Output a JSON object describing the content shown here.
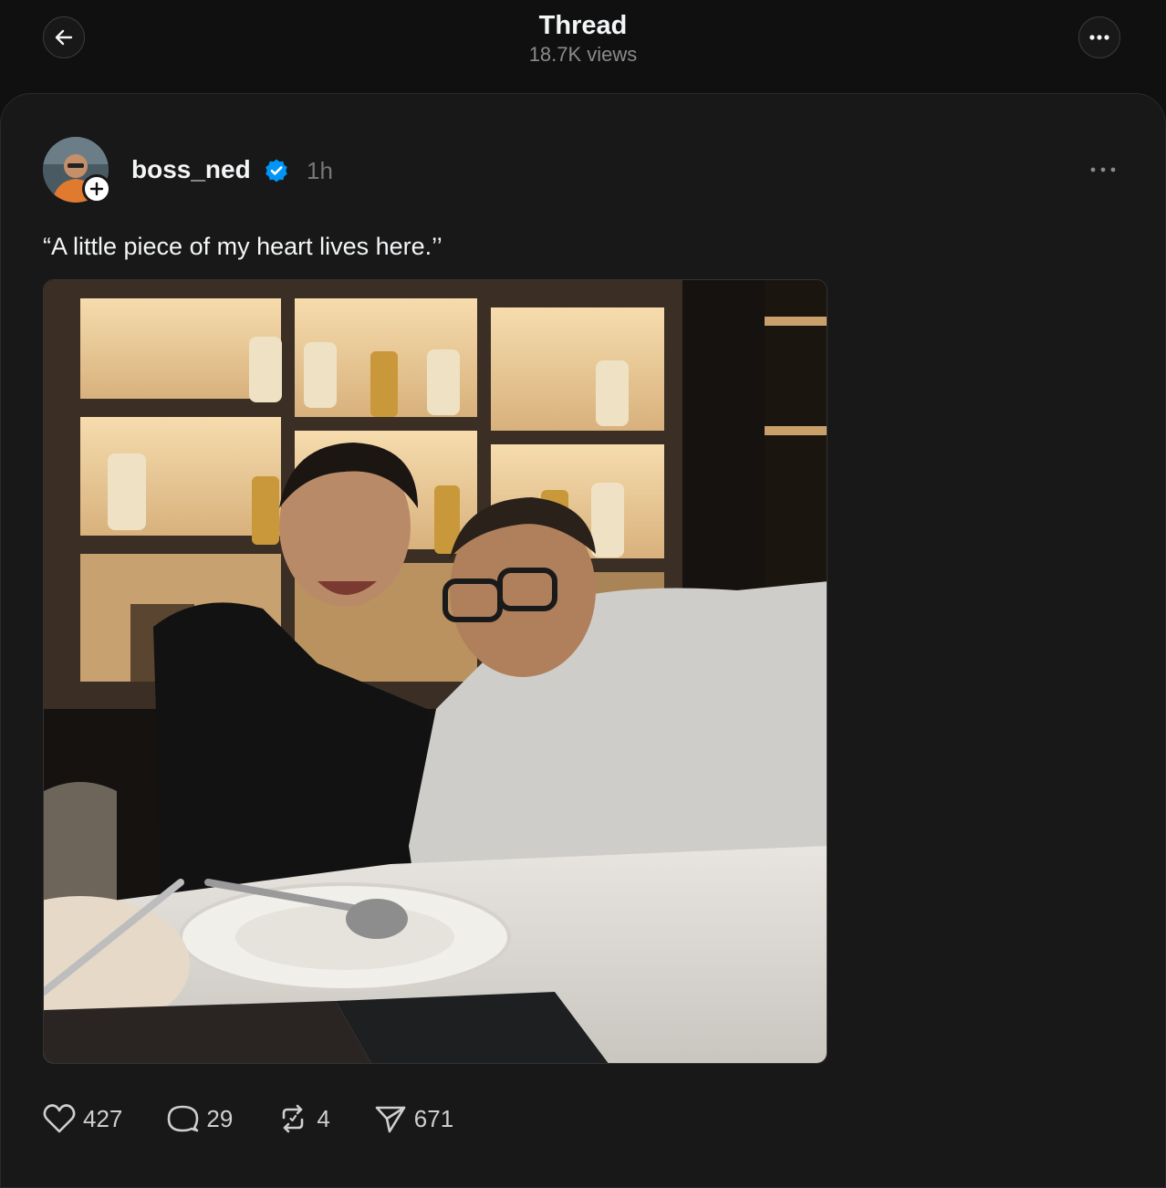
{
  "header": {
    "title": "Thread",
    "views": "18.7K views"
  },
  "post": {
    "username": "boss_ned",
    "time": "1h",
    "caption": "“A little piece of my heart lives here.’’",
    "stats": {
      "likes": "427",
      "replies": "29",
      "reposts": "4",
      "shares": "671"
    }
  },
  "icons": {
    "back": "arrow-left-icon",
    "more": "ellipsis-icon",
    "verified": "verified-badge-icon",
    "like": "heart-icon",
    "reply": "comment-bubble-icon",
    "repost": "repost-icon",
    "share": "paper-plane-icon"
  },
  "colors": {
    "background": "#101010",
    "card": "#181818",
    "text_primary": "#f3f5f7",
    "text_secondary": "#8a8a8a",
    "verified": "#0095f6"
  }
}
